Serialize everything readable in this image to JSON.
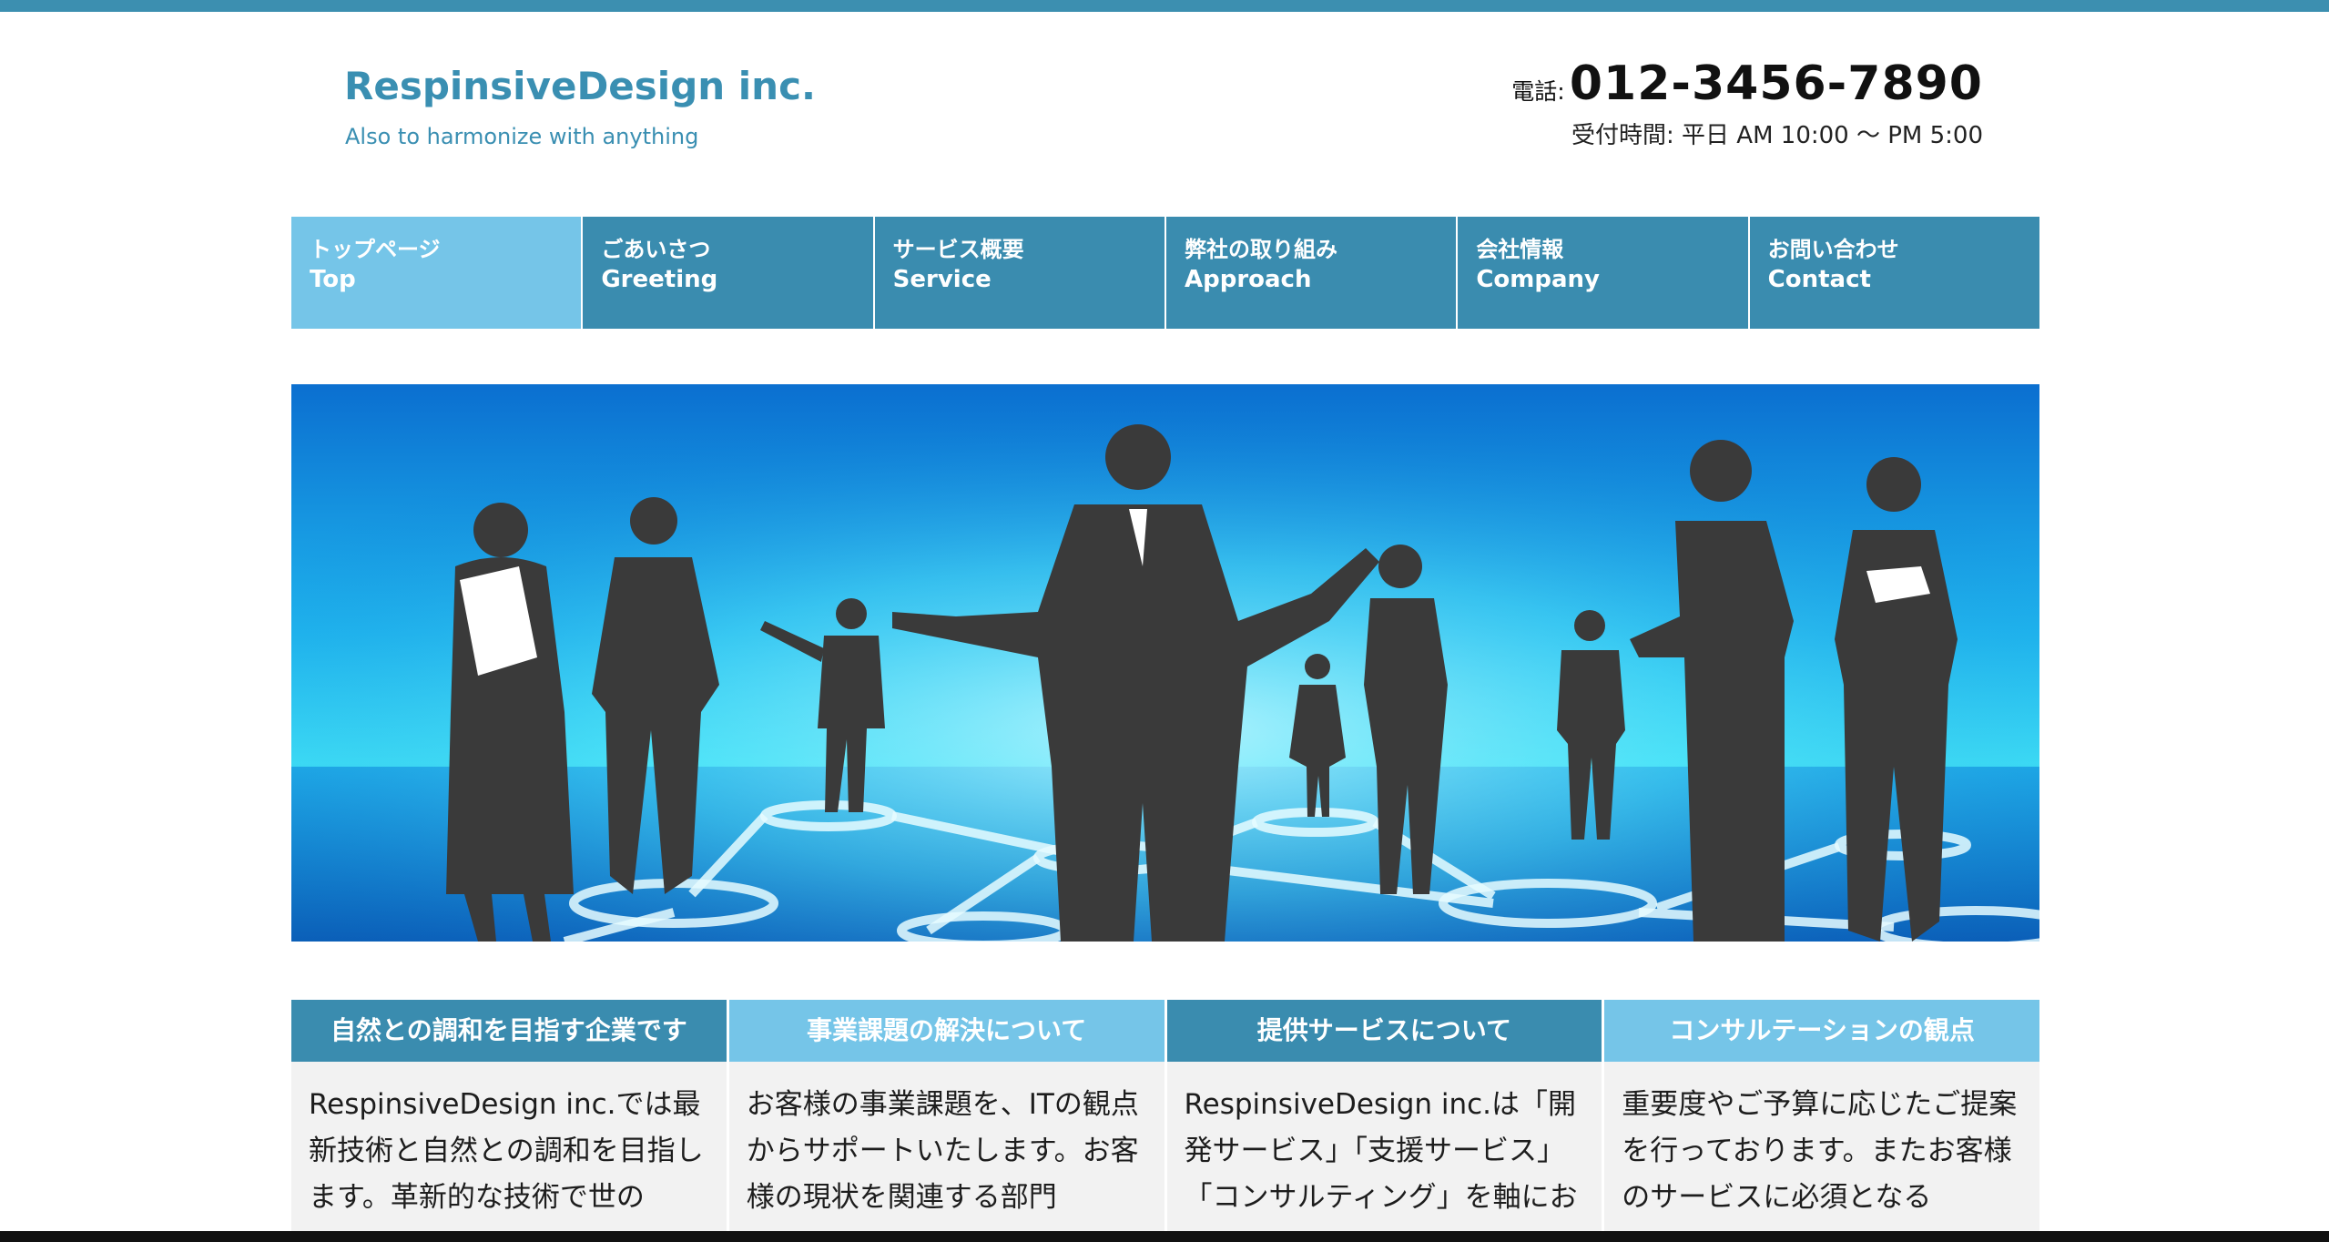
{
  "header": {
    "logo": "RespinsiveDesign inc.",
    "tagline": "Also to harmonize with anything",
    "phone_label": "電話:",
    "phone_number": "012-3456-7890",
    "hours": "受付時間: 平日 AM 10:00 〜 PM 5:00"
  },
  "nav": {
    "items": [
      {
        "jp": "トップページ",
        "en": "Top",
        "active": true
      },
      {
        "jp": "ごあいさつ",
        "en": "Greeting",
        "active": false
      },
      {
        "jp": "サービス概要",
        "en": "Service",
        "active": false
      },
      {
        "jp": "弊社の取り組み",
        "en": "Approach",
        "active": false
      },
      {
        "jp": "会社情報",
        "en": "Company",
        "active": false
      },
      {
        "jp": "お問い合わせ",
        "en": "Contact",
        "active": false
      }
    ]
  },
  "hero": {
    "image_name": "business-people-silhouettes-network-image"
  },
  "columns": [
    {
      "heading": "自然との調和を目指す企業です",
      "body": "RespinsiveDesign inc.では最新技術と自然との調和を目指します。革新的な技術で世の"
    },
    {
      "heading": "事業課題の解決について",
      "body": "お客様の事業課題を、ITの観点からサポートいたします。お客様の現状を関連する部門"
    },
    {
      "heading": "提供サービスについて",
      "body": "RespinsiveDesign inc.は「開発サービス」「支援サービス」「コンサルティング」を軸にお"
    },
    {
      "heading": "コンサルテーションの観点",
      "body": "重要度やご予算に応じたご提案を行っております。またお客様のサービスに必須となる"
    }
  ],
  "colors": {
    "primary": "#3a8caf",
    "accent": "#75c5e8",
    "topbar": "#3c8fb0"
  }
}
